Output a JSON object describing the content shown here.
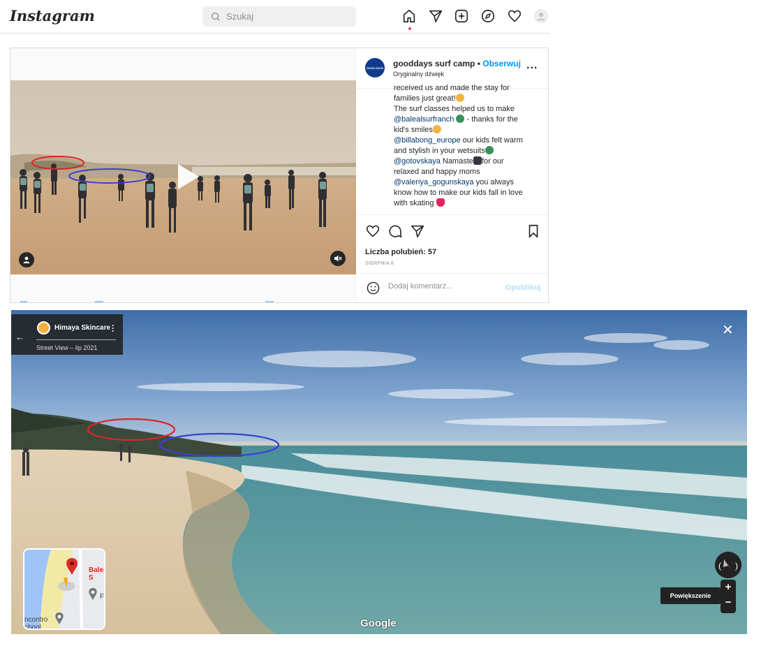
{
  "instagram": {
    "logo": "Instagram",
    "logo_chevron": "⌄",
    "search_placeholder": "Szukaj",
    "nav_icons": [
      "home-icon",
      "direct-icon",
      "new-post-icon",
      "explore-icon",
      "activity-icon",
      "profile-avatar"
    ],
    "post": {
      "avatar_text": "GOOD DAYS",
      "username": "gooddays surf camp",
      "separator": "•",
      "follow_label": "Obserwuj",
      "audio": "Oryginalny dźwięk",
      "more": "...",
      "caption": [
        {
          "text": "received us and made the stay for"
        },
        {
          "text": "families just great!",
          "emoji": "smile"
        },
        {
          "text": "The surf classes helped us to make"
        },
        {
          "mention": "@balealsurfranch",
          "emoji": "surf",
          "text": " - thanks for the"
        },
        {
          "text": "kid's smiles",
          "emoji": "smile"
        },
        {
          "mention": "@billabong_europe",
          "text": " our kids felt warm"
        },
        {
          "text": "and stylish in your wetsuits",
          "emoji": "surf"
        },
        {
          "mention": "@gotovskaya",
          "text": " Namaste",
          "emoji": "yoga",
          "text2": "for our"
        },
        {
          "text": "relaxed and happy moms"
        },
        {
          "mention": "@valeriya_gogunskaya",
          "text": " you always"
        },
        {
          "text": "know how to make our kids fall in love"
        },
        {
          "text": "with skating",
          "emoji": "heart"
        }
      ],
      "likes": "Liczba polubień: 57",
      "date": "SIERPNIA 8",
      "comment_placeholder": "Dodaj komentarz...",
      "publish_label": "Opublikuj"
    }
  },
  "street_view": {
    "place_name": "Himaya Skincare",
    "date_label": "Street View – lip 2021",
    "back_icon": "←",
    "close_icon": "✕",
    "zoom_in": "+",
    "zoom_out": "−",
    "zoom_tooltip": "Powiększenie",
    "watermark": "Google",
    "minimap": {
      "place_label": "Baleal S",
      "poi_label": "F",
      "school_label_1": "ncontro",
      "school_label_2": "chool..."
    }
  },
  "colors": {
    "ig_link": "#0095f6",
    "ig_mention": "#00376b",
    "annotation_red": "#d9262c",
    "annotation_blue": "#3b3fd1",
    "sv_panel": "#212121"
  }
}
